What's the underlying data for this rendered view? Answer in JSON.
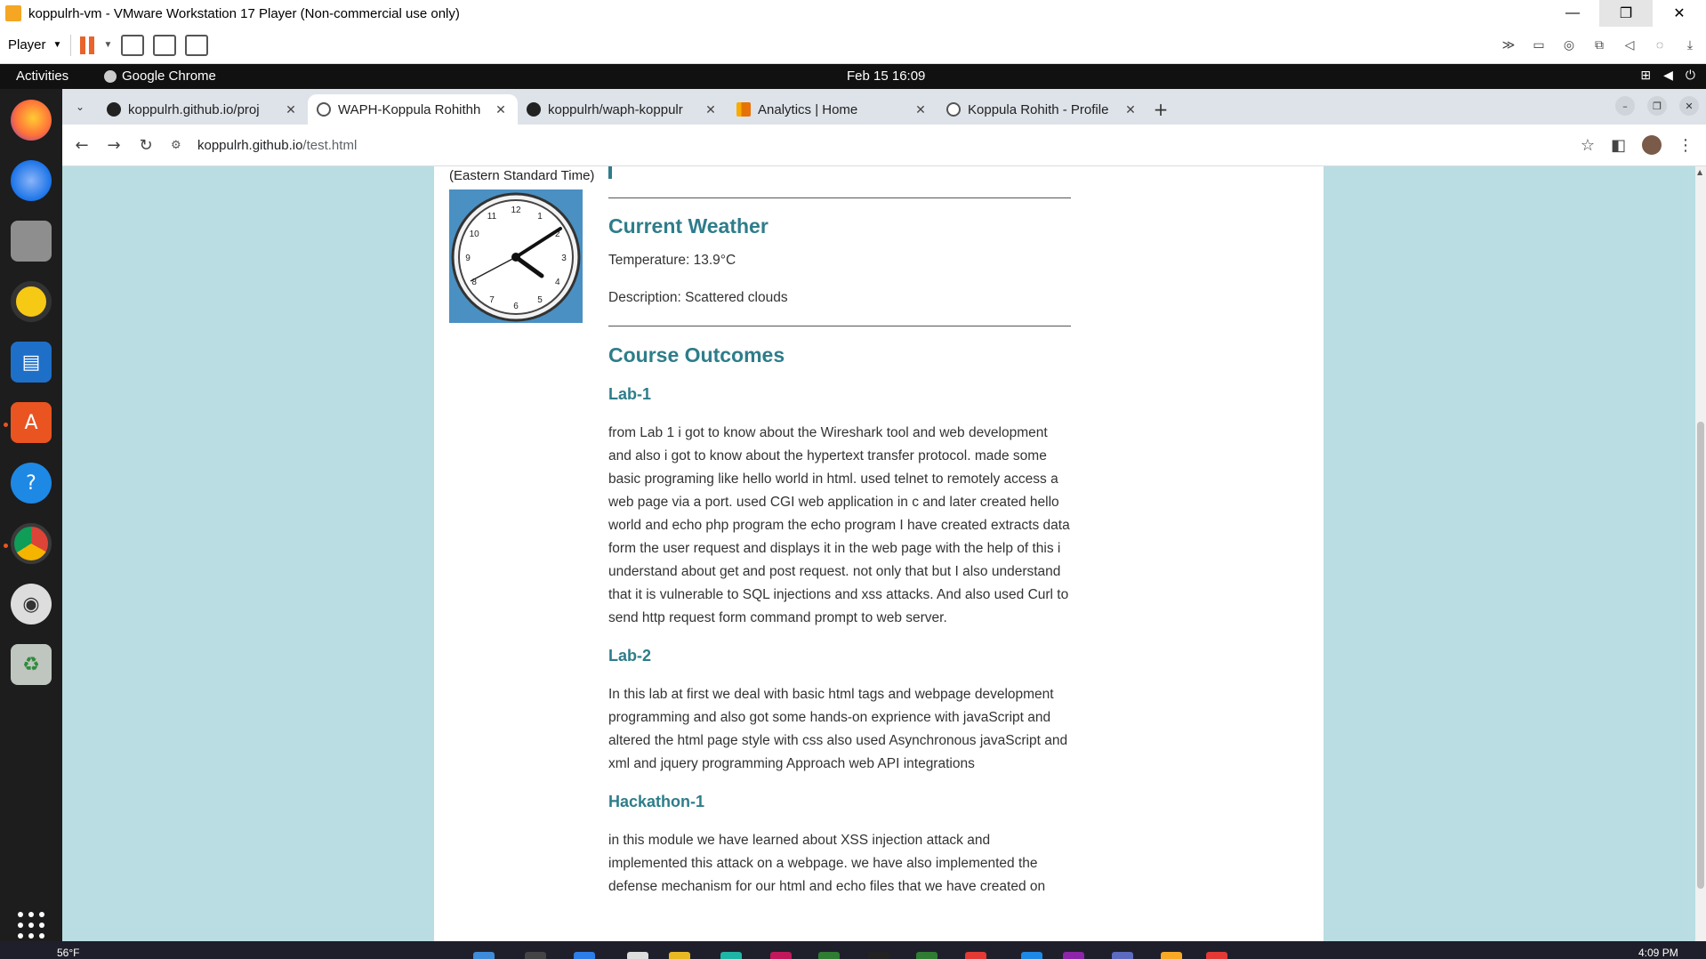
{
  "vmware": {
    "window_title": "koppulrh-vm - VMware Workstation 17 Player (Non-commercial use only)",
    "player_menu": "Player",
    "minimize": "—",
    "restore": "❐",
    "close": "✕"
  },
  "gnome": {
    "activities": "Activities",
    "app_name": "Google Chrome",
    "datetime": "Feb 15  16:09"
  },
  "chrome": {
    "tabs": [
      {
        "title": "koppulrh.github.io/proj",
        "icon": "github-icon"
      },
      {
        "title": "WAPH-Koppula Rohithh",
        "icon": "globe-icon"
      },
      {
        "title": "koppulrh/waph-koppulr",
        "icon": "github-icon"
      },
      {
        "title": "Analytics | Home",
        "icon": "analytics-icon"
      },
      {
        "title": "Koppula Rohith - Profile",
        "icon": "globe-icon"
      }
    ],
    "tab_close": "✕",
    "new_tab": "+",
    "url_host": "koppulrh.github.io",
    "url_path": "/test.html"
  },
  "page": {
    "timezone_label": "(Eastern Standard Time)",
    "clock_numbers": [
      "12",
      "1",
      "2",
      "3",
      "4",
      "5",
      "6",
      "7",
      "8",
      "9",
      "10",
      "11"
    ],
    "weather": {
      "heading": "Current Weather",
      "temperature": "Temperature: 13.9°C",
      "description": "Description: Scattered clouds"
    },
    "outcomes": {
      "heading": "Course Outcomes",
      "sections": [
        {
          "title": "Lab-1",
          "text": "from Lab 1 i got to know about the Wireshark tool and web development and also i got to know about the hypertext transfer protocol. made some basic programing like hello world in html. used telnet to remotely access a web page via a port. used CGI web application in c and later created hello world and echo php program the echo program I have created extracts data form the user request and displays it in the web page with the help of this i understand about get and post request. not only that but I also understand that it is vulnerable to SQL injections and xss attacks. And also used Curl to send http request form command prompt to web server."
        },
        {
          "title": "Lab-2",
          "text": "In this lab at first we deal with basic html tags and webpage development programming and also got some hands-on exprience with javaScript and altered the html page style with css also used Asynchronous javaScript and xml and jquery programming Approach web API integrations"
        },
        {
          "title": "Hackathon-1",
          "text": "in this module we have learned about XSS injection attack and implemented this attack on a webpage. we have also implemented the defense mechanism for our html and echo files that we have created on"
        }
      ]
    }
  },
  "taskbar": {
    "weather": "56°F",
    "time": "4:09 PM"
  },
  "colors": {
    "page_bg": "#b9dde2",
    "heading": "#2e7d8a",
    "clock_bg": "#4a90c2",
    "dock_bg": "#1d1d1d"
  }
}
